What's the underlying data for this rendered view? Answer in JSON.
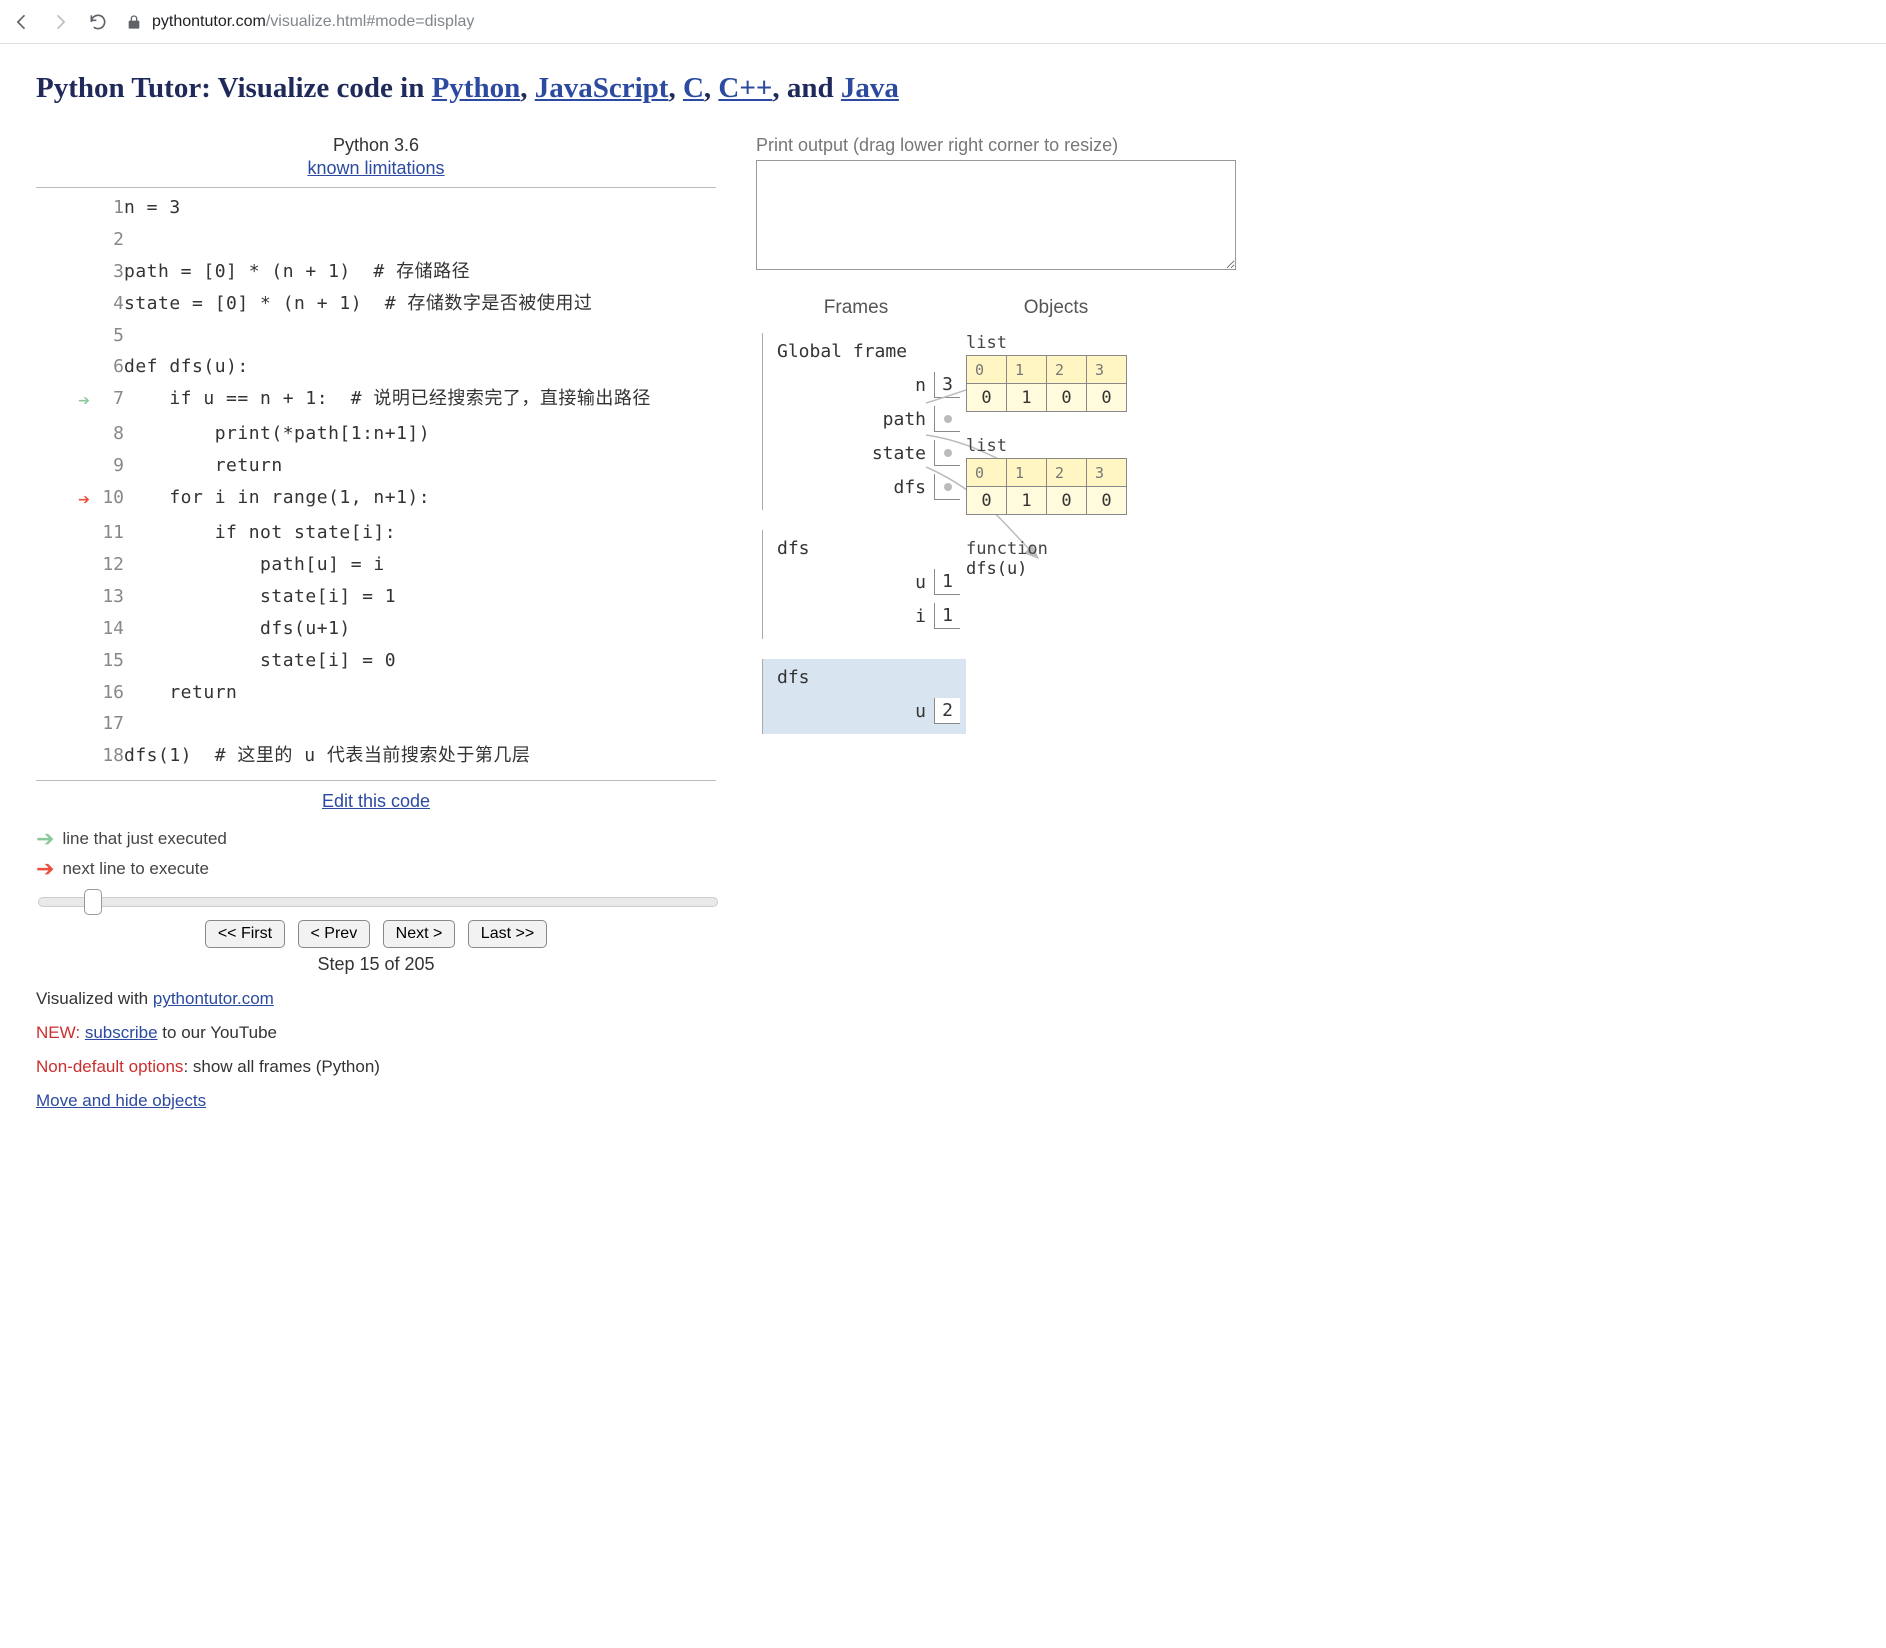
{
  "browser": {
    "url_host": "pythontutor.com",
    "url_path": "/visualize.html#mode=display"
  },
  "title": {
    "prefix": "Python Tutor: Visualize code in ",
    "links": [
      "Python",
      "JavaScript",
      "C",
      "C++",
      "Java"
    ],
    "sep": ", ",
    "penult": ", and "
  },
  "header": {
    "python_ver": "Python 3.6",
    "known_limitations": "known limitations"
  },
  "code_lines": [
    "n = 3",
    "",
    "path = [0] * (n + 1)  # 存储路径",
    "state = [0] * (n + 1)  # 存储数字是否被使用过",
    "",
    "def dfs(u):",
    "    if u == n + 1:  # 说明已经搜索完了，直接输出路径",
    "        print(*path[1:n+1])",
    "        return",
    "    for i in range(1, n+1):",
    "        if not state[i]:",
    "            path[u] = i",
    "            state[i] = 1",
    "            dfs(u+1)",
    "            state[i] = 0",
    "    return",
    "",
    "dfs(1)  # 这里的 u 代表当前搜索处于第几层"
  ],
  "arrows": {
    "prev_line": 7,
    "next_line": 10
  },
  "edit_link": "Edit this code",
  "legend": {
    "prev": "line that just executed",
    "next": "next line to execute"
  },
  "controls": {
    "first": "<< First",
    "prev": "< Prev",
    "next": "Next >",
    "last": "Last >>",
    "step_current": 15,
    "step_total": 205,
    "step_label_prefix": "Step ",
    "step_label_mid": " of "
  },
  "footer": {
    "visualized_with": "Visualized with ",
    "pt_link": "pythontutor.com",
    "new_prefix": "NEW: ",
    "subscribe": "subscribe",
    "subscribe_suffix": " to our YouTube",
    "nondefault_prefix": "Non-default options",
    "nondefault_suffix": ": show all frames (Python)",
    "move_hide": "Move and hide objects"
  },
  "right": {
    "output_hdr": "Print output (drag lower right corner to resize)",
    "frames_label": "Frames",
    "objects_label": "Objects"
  },
  "frames": [
    {
      "name": "Global frame",
      "highlighted": false,
      "vars": [
        {
          "name": "n",
          "value": "3",
          "ptr": false
        },
        {
          "name": "path",
          "ptr": true
        },
        {
          "name": "state",
          "ptr": true
        },
        {
          "name": "dfs",
          "ptr": true
        }
      ]
    },
    {
      "name": "dfs",
      "highlighted": false,
      "vars": [
        {
          "name": "u",
          "value": "1",
          "ptr": false
        },
        {
          "name": "i",
          "value": "1",
          "ptr": false
        }
      ]
    },
    {
      "name": "dfs",
      "highlighted": true,
      "vars": [
        {
          "name": "u",
          "value": "2",
          "ptr": false
        }
      ]
    }
  ],
  "objects": {
    "list1": {
      "label": "list",
      "idx": [
        "0",
        "1",
        "2",
        "3"
      ],
      "val": [
        "0",
        "1",
        "0",
        "0"
      ]
    },
    "list2": {
      "label": "list",
      "idx": [
        "0",
        "1",
        "2",
        "3"
      ],
      "val": [
        "0",
        "1",
        "0",
        "0"
      ]
    },
    "func": {
      "label": "function",
      "sig": "dfs(u)"
    }
  }
}
